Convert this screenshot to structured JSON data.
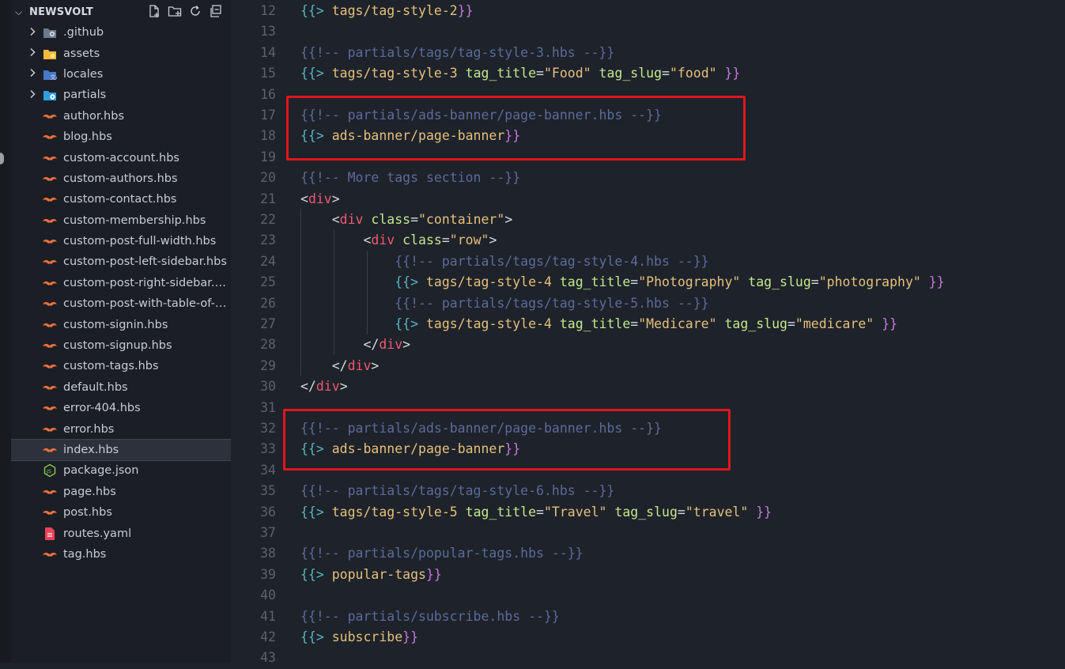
{
  "explorer": {
    "title": "NEWSVOLT",
    "items": [
      {
        "label": ".github",
        "type": "folder",
        "icon": "github-folder-icon"
      },
      {
        "label": "assets",
        "type": "folder",
        "icon": "assets-folder-icon"
      },
      {
        "label": "locales",
        "type": "folder",
        "icon": "locales-folder-icon"
      },
      {
        "label": "partials",
        "type": "folder",
        "icon": "partials-folder-icon"
      },
      {
        "label": "author.hbs",
        "type": "file",
        "icon": "handlebars-file-icon"
      },
      {
        "label": "blog.hbs",
        "type": "file",
        "icon": "handlebars-file-icon"
      },
      {
        "label": "custom-account.hbs",
        "type": "file",
        "icon": "handlebars-file-icon"
      },
      {
        "label": "custom-authors.hbs",
        "type": "file",
        "icon": "handlebars-file-icon"
      },
      {
        "label": "custom-contact.hbs",
        "type": "file",
        "icon": "handlebars-file-icon"
      },
      {
        "label": "custom-membership.hbs",
        "type": "file",
        "icon": "handlebars-file-icon"
      },
      {
        "label": "custom-post-full-width.hbs",
        "type": "file",
        "icon": "handlebars-file-icon"
      },
      {
        "label": "custom-post-left-sidebar.hbs",
        "type": "file",
        "icon": "handlebars-file-icon"
      },
      {
        "label": "custom-post-right-sidebar.h...",
        "type": "file",
        "icon": "handlebars-file-icon"
      },
      {
        "label": "custom-post-with-table-of-c...",
        "type": "file",
        "icon": "handlebars-file-icon"
      },
      {
        "label": "custom-signin.hbs",
        "type": "file",
        "icon": "handlebars-file-icon"
      },
      {
        "label": "custom-signup.hbs",
        "type": "file",
        "icon": "handlebars-file-icon"
      },
      {
        "label": "custom-tags.hbs",
        "type": "file",
        "icon": "handlebars-file-icon"
      },
      {
        "label": "default.hbs",
        "type": "file",
        "icon": "handlebars-file-icon"
      },
      {
        "label": "error-404.hbs",
        "type": "file",
        "icon": "handlebars-file-icon"
      },
      {
        "label": "error.hbs",
        "type": "file",
        "icon": "handlebars-file-icon"
      },
      {
        "label": "index.hbs",
        "type": "file",
        "icon": "handlebars-file-icon",
        "selected": true
      },
      {
        "label": "package.json",
        "type": "file",
        "icon": "nodejs-file-icon"
      },
      {
        "label": "page.hbs",
        "type": "file",
        "icon": "handlebars-file-icon"
      },
      {
        "label": "post.hbs",
        "type": "file",
        "icon": "handlebars-file-icon"
      },
      {
        "label": "routes.yaml",
        "type": "file",
        "icon": "yaml-file-icon"
      },
      {
        "label": "tag.hbs",
        "type": "file",
        "icon": "handlebars-file-icon"
      }
    ]
  },
  "editor": {
    "lines": [
      {
        "n": "12",
        "parts": [
          [
            "{{> ",
            "brace"
          ],
          [
            "tags/tag-style-2",
            "kw"
          ],
          [
            "}}",
            "brace2"
          ]
        ]
      },
      {
        "n": "13",
        "parts": []
      },
      {
        "n": "14",
        "parts": [
          [
            "{{!-- partials/tags/tag-style-3.hbs --}}",
            "comment"
          ]
        ]
      },
      {
        "n": "15",
        "parts": [
          [
            "{{> ",
            "brace"
          ],
          [
            "tags/tag-style-3 ",
            "kw"
          ],
          [
            "tag_title",
            "attr"
          ],
          [
            "=",
            "white"
          ],
          [
            "\"Food\"",
            "str"
          ],
          [
            " ",
            "white"
          ],
          [
            "tag_slug",
            "attr"
          ],
          [
            "=",
            "white"
          ],
          [
            "\"food\"",
            "str"
          ],
          [
            " ",
            "white"
          ],
          [
            "}}",
            "brace2"
          ]
        ]
      },
      {
        "n": "16",
        "parts": []
      },
      {
        "n": "17",
        "parts": [
          [
            "{{!-- partials/ads-banner/page-banner.hbs --}}",
            "comment"
          ]
        ]
      },
      {
        "n": "18",
        "parts": [
          [
            "{{> ",
            "brace"
          ],
          [
            "ads-banner/page-banner",
            "kw"
          ],
          [
            "}}",
            "brace2"
          ]
        ]
      },
      {
        "n": "19",
        "parts": []
      },
      {
        "n": "20",
        "parts": [
          [
            "{{!-- More tags section --}}",
            "comment"
          ]
        ]
      },
      {
        "n": "21",
        "parts": [
          [
            "<",
            "white"
          ],
          [
            "div",
            "tag"
          ],
          [
            ">",
            "white"
          ]
        ]
      },
      {
        "n": "22",
        "parts": [
          [
            "    <",
            "white"
          ],
          [
            "div",
            "tag"
          ],
          [
            " ",
            "white"
          ],
          [
            "class",
            "attr"
          ],
          [
            "=",
            "white"
          ],
          [
            "\"container\"",
            "str"
          ],
          [
            ">",
            "white"
          ]
        ]
      },
      {
        "n": "23",
        "parts": [
          [
            "        <",
            "white"
          ],
          [
            "div",
            "tag"
          ],
          [
            " ",
            "white"
          ],
          [
            "class",
            "attr"
          ],
          [
            "=",
            "white"
          ],
          [
            "\"row\"",
            "str"
          ],
          [
            ">",
            "white"
          ]
        ]
      },
      {
        "n": "24",
        "parts": [
          [
            "            ",
            "white"
          ],
          [
            "{{!-- partials/tags/tag-style-4.hbs --}}",
            "comment"
          ]
        ]
      },
      {
        "n": "25",
        "parts": [
          [
            "            ",
            "white"
          ],
          [
            "{{> ",
            "brace"
          ],
          [
            "tags/tag-style-4 ",
            "kw"
          ],
          [
            "tag_title",
            "attr"
          ],
          [
            "=",
            "white"
          ],
          [
            "\"Photography\"",
            "str"
          ],
          [
            " ",
            "white"
          ],
          [
            "tag_slug",
            "attr"
          ],
          [
            "=",
            "white"
          ],
          [
            "\"photography\"",
            "str"
          ],
          [
            " ",
            "white"
          ],
          [
            "}}",
            "brace2"
          ]
        ]
      },
      {
        "n": "26",
        "parts": [
          [
            "            ",
            "white"
          ],
          [
            "{{!-- partials/tags/tag-style-5.hbs --}}",
            "comment"
          ]
        ]
      },
      {
        "n": "27",
        "parts": [
          [
            "            ",
            "white"
          ],
          [
            "{{> ",
            "brace"
          ],
          [
            "tags/tag-style-4 ",
            "kw"
          ],
          [
            "tag_title",
            "attr"
          ],
          [
            "=",
            "white"
          ],
          [
            "\"Medicare\"",
            "str"
          ],
          [
            " ",
            "white"
          ],
          [
            "tag_slug",
            "attr"
          ],
          [
            "=",
            "white"
          ],
          [
            "\"medicare\"",
            "str"
          ],
          [
            " ",
            "white"
          ],
          [
            "}}",
            "brace2"
          ]
        ]
      },
      {
        "n": "28",
        "parts": [
          [
            "        </",
            "white"
          ],
          [
            "div",
            "tag"
          ],
          [
            ">",
            "white"
          ]
        ]
      },
      {
        "n": "29",
        "parts": [
          [
            "    </",
            "white"
          ],
          [
            "div",
            "tag"
          ],
          [
            ">",
            "white"
          ]
        ]
      },
      {
        "n": "30",
        "parts": [
          [
            "</",
            "white"
          ],
          [
            "div",
            "tag"
          ],
          [
            ">",
            "white"
          ]
        ]
      },
      {
        "n": "31",
        "parts": []
      },
      {
        "n": "32",
        "parts": [
          [
            "{{!-- partials/ads-banner/page-banner.hbs --}}",
            "comment"
          ]
        ]
      },
      {
        "n": "33",
        "parts": [
          [
            "{{> ",
            "brace"
          ],
          [
            "ads-banner/page-banner",
            "kw"
          ],
          [
            "}}",
            "brace2"
          ]
        ]
      },
      {
        "n": "34",
        "parts": []
      },
      {
        "n": "35",
        "parts": [
          [
            "{{!-- partials/tags/tag-style-6.hbs --}}",
            "comment"
          ]
        ]
      },
      {
        "n": "36",
        "parts": [
          [
            "{{> ",
            "brace"
          ],
          [
            "tags/tag-style-5 ",
            "kw"
          ],
          [
            "tag_title",
            "attr"
          ],
          [
            "=",
            "white"
          ],
          [
            "\"Travel\"",
            "str"
          ],
          [
            " ",
            "white"
          ],
          [
            "tag_slug",
            "attr"
          ],
          [
            "=",
            "white"
          ],
          [
            "\"travel\"",
            "str"
          ],
          [
            " ",
            "white"
          ],
          [
            "}}",
            "brace2"
          ]
        ]
      },
      {
        "n": "37",
        "parts": []
      },
      {
        "n": "38",
        "parts": [
          [
            "{{!-- partials/popular-tags.hbs --}}",
            "comment"
          ]
        ]
      },
      {
        "n": "39",
        "parts": [
          [
            "{{> ",
            "brace"
          ],
          [
            "popular-tags",
            "kw"
          ],
          [
            "}}",
            "brace2"
          ]
        ]
      },
      {
        "n": "40",
        "parts": []
      },
      {
        "n": "41",
        "parts": [
          [
            "{{!-- partials/subscribe.hbs --}}",
            "comment"
          ]
        ]
      },
      {
        "n": "42",
        "parts": [
          [
            "{{> ",
            "brace"
          ],
          [
            "subscribe",
            "kw"
          ],
          [
            "}}",
            "brace2"
          ]
        ]
      },
      {
        "n": "43",
        "parts": []
      }
    ]
  },
  "colors": {
    "highlight_box": "#e0161b",
    "selection": "#2c313c"
  }
}
